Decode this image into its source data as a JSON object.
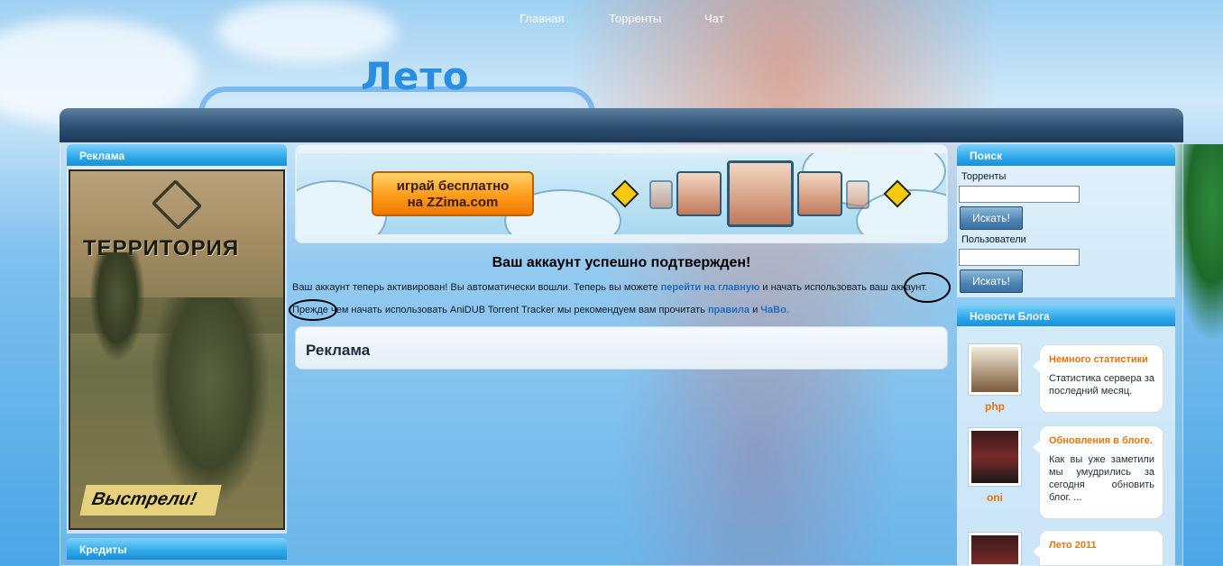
{
  "header": {
    "logo": "Лето"
  },
  "nav": {
    "items": [
      "Главная",
      "Торренты",
      "Чат"
    ]
  },
  "left": {
    "ads_title": "Реклама",
    "ad_game_title": "ТЕРРИТОРИЯ",
    "ad_slogan": "Выстрели!",
    "credits_title": "Кредиты"
  },
  "banner": {
    "promo_line1": "играй бесплатно",
    "promo_line2": "на ZZima.com"
  },
  "main": {
    "confirm_title": "Ваш аккаунт успешно подтвержден!",
    "line1_a": "Ваш аккаунт теперь активирован! Вы автоматически вошли. Теперь вы можете ",
    "line1_link": "перейти на главную",
    "line1_b": " и начать использовать ваш аккаунт.",
    "line2_a": "Прежде чем начать использовать AniDUB Torrent Tracker мы рекомендуем вам прочитать ",
    "line2_link1": "правила",
    "line2_mid": " и ",
    "line2_link2": "ЧаВо",
    "line2_end": ".",
    "ads_title": "Реклама"
  },
  "search": {
    "title": "Поиск",
    "torrents_label": "Торренты",
    "torrents_value": "",
    "users_label": "Пользователи",
    "users_value": "",
    "button": "Искать!"
  },
  "blog": {
    "title": "Новости Блога",
    "posts": [
      {
        "user": "php",
        "title": "Немного статистики",
        "text": "Статистика сервера за последний месяц."
      },
      {
        "user": "oni",
        "title": "Обновления в блоге.",
        "text": "Как вы уже заметили мы умудрились за сегодня обновить блог. ..."
      },
      {
        "user": "",
        "title": "Лето 2011",
        "text": ""
      }
    ]
  },
  "colors": {
    "nav_bg": "#2c4f71",
    "panel_head": "#2ea8ea",
    "link": "#1f6dc0",
    "blog_accent": "#e0760f"
  }
}
